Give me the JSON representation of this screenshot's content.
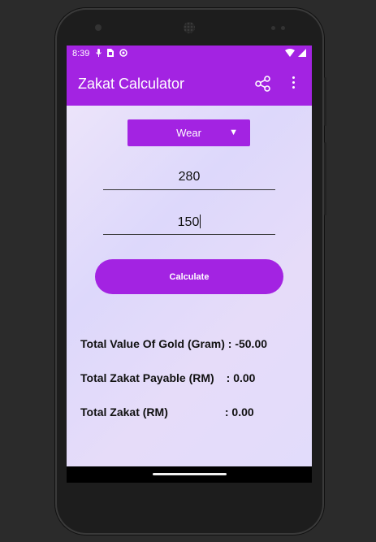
{
  "status_bar": {
    "time": "8:39",
    "icons": [
      "mic-icon",
      "sim-card-icon",
      "sync-icon",
      "wifi-icon",
      "signal-icon"
    ]
  },
  "app_bar": {
    "title": "Zakat Calculator",
    "actions": [
      "share-icon",
      "more-options-icon"
    ],
    "color": "#a323e2"
  },
  "form": {
    "type_select": {
      "selected": "Wear"
    },
    "gold_weight_input": {
      "value": "280"
    },
    "uruf_input": {
      "value": "150"
    },
    "calculate_label": "Calculate"
  },
  "results": {
    "gold_value_label": "Total Value Of Gold (Gram)",
    "gold_value": ": -50.00",
    "zakat_payable_label": "Total Zakat Payable (RM)",
    "zakat_payable": ": 0.00",
    "total_zakat_label": "Total Zakat (RM)",
    "total_zakat": ": 0.00"
  }
}
